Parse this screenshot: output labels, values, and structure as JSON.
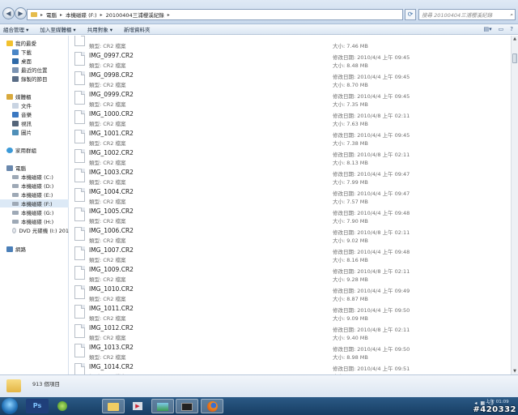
{
  "address": {
    "crumbs": [
      "電腦",
      "本機磁碟 (F:)",
      "20100404三浦櫻溪紀錄"
    ],
    "search_placeholder": "搜尋 20100404三浦櫻溪紀錄"
  },
  "toolbar": {
    "organize": "組合管理 ▾",
    "add_to_library": "加入至媒體櫃 ▾",
    "share_with": "共用對象 ▾",
    "new_folder": "新增資料夾"
  },
  "nav": {
    "favorites": "我的最愛",
    "downloads": "下載",
    "desktop": "桌面",
    "recent": "最近的位置",
    "recorded_tv": "錄製的節目",
    "libraries": "媒體櫃",
    "documents": "文件",
    "music": "音樂",
    "videos": "視訊",
    "pictures": "圖片",
    "homegroup": "家用群組",
    "computer": "電腦",
    "drives": [
      "本機磁碟 (C:)",
      "本機磁碟 (D:)",
      "本機磁碟 (E:)",
      "本機磁碟 (F:)",
      "本機磁碟 (G:)",
      "本機磁碟 (H:)",
      "DVD 光碟機 (I:) 201"
    ],
    "network": "網路"
  },
  "files": [
    {
      "name": "",
      "type": "類型: CR2 檔案",
      "date": "",
      "size": "大小: 7.46 MB"
    },
    {
      "name": "IMG_0997.CR2",
      "type": "類型: CR2 檔案",
      "date": "修改日期: 2010/4/4 上午 09:45",
      "size": "大小: 8.48 MB"
    },
    {
      "name": "IMG_0998.CR2",
      "type": "類型: CR2 檔案",
      "date": "修改日期: 2010/4/4 上午 09:45",
      "size": "大小: 8.70 MB"
    },
    {
      "name": "IMG_0999.CR2",
      "type": "類型: CR2 檔案",
      "date": "修改日期: 2010/4/4 上午 09:45",
      "size": "大小: 7.35 MB"
    },
    {
      "name": "IMG_1000.CR2",
      "type": "類型: CR2 檔案",
      "date": "修改日期: 2010/4/8 上午 02:11",
      "size": "大小: 7.63 MB"
    },
    {
      "name": "IMG_1001.CR2",
      "type": "類型: CR2 檔案",
      "date": "修改日期: 2010/4/4 上午 09:45",
      "size": "大小: 7.38 MB"
    },
    {
      "name": "IMG_1002.CR2",
      "type": "類型: CR2 檔案",
      "date": "修改日期: 2010/4/8 上午 02:11",
      "size": "大小: 8.13 MB"
    },
    {
      "name": "IMG_1003.CR2",
      "type": "類型: CR2 檔案",
      "date": "修改日期: 2010/4/4 上午 09:47",
      "size": "大小: 7.99 MB"
    },
    {
      "name": "IMG_1004.CR2",
      "type": "類型: CR2 檔案",
      "date": "修改日期: 2010/4/4 上午 09:47",
      "size": "大小: 7.57 MB"
    },
    {
      "name": "IMG_1005.CR2",
      "type": "類型: CR2 檔案",
      "date": "修改日期: 2010/4/4 上午 09:48",
      "size": "大小: 7.90 MB"
    },
    {
      "name": "IMG_1006.CR2",
      "type": "類型: CR2 檔案",
      "date": "修改日期: 2010/4/8 上午 02:11",
      "size": "大小: 9.02 MB"
    },
    {
      "name": "IMG_1007.CR2",
      "type": "類型: CR2 檔案",
      "date": "修改日期: 2010/4/4 上午 09:48",
      "size": "大小: 8.16 MB"
    },
    {
      "name": "IMG_1009.CR2",
      "type": "類型: CR2 檔案",
      "date": "修改日期: 2010/4/8 上午 02:11",
      "size": "大小: 9.28 MB"
    },
    {
      "name": "IMG_1010.CR2",
      "type": "類型: CR2 檔案",
      "date": "修改日期: 2010/4/4 上午 09:49",
      "size": "大小: 8.87 MB"
    },
    {
      "name": "IMG_1011.CR2",
      "type": "類型: CR2 檔案",
      "date": "修改日期: 2010/4/4 上午 09:50",
      "size": "大小: 9.09 MB"
    },
    {
      "name": "IMG_1012.CR2",
      "type": "類型: CR2 檔案",
      "date": "修改日期: 2010/4/8 上午 02:11",
      "size": "大小: 9.40 MB"
    },
    {
      "name": "IMG_1013.CR2",
      "type": "類型: CR2 檔案",
      "date": "修改日期: 2010/4/4 上午 09:50",
      "size": "大小: 8.98 MB"
    },
    {
      "name": "IMG_1014.CR2",
      "type": "類型: CR2 檔案",
      "date": "修改日期: 2010/4/4 上午 09:51",
      "size": "大小: 7.44 MB"
    }
  ],
  "details": {
    "item_count": "913 個項目"
  },
  "taskbar": {
    "clock_time": "上午 01:09",
    "watermark": "#420332",
    "apps": [
      "start-orb-icon",
      "photoshop-icon",
      "windows-media-player-icon",
      "file-explorer-icon",
      "media-player-icon",
      "network-game-icon",
      "photo-viewer-icon",
      "firefox-icon"
    ]
  }
}
